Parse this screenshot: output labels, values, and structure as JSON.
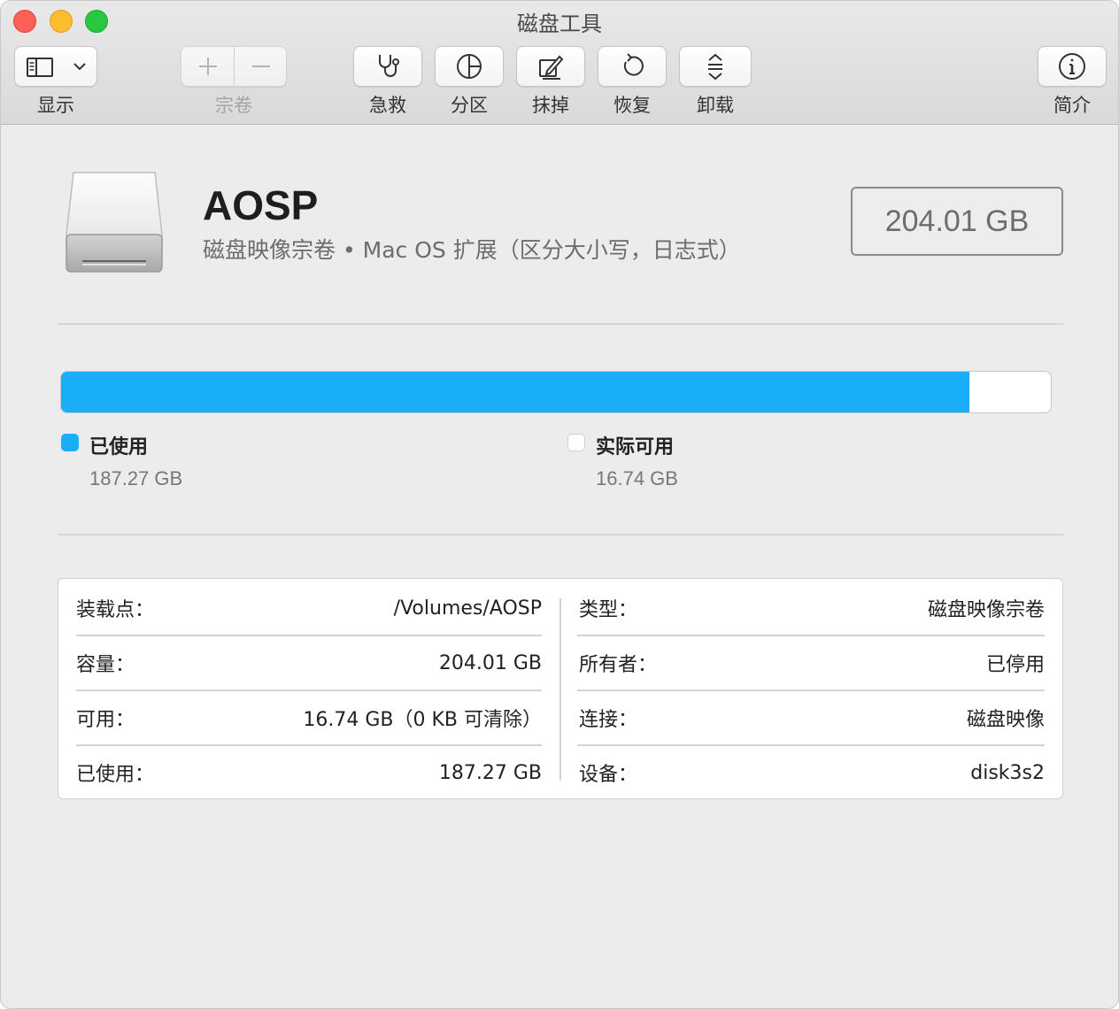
{
  "window": {
    "title": "磁盘工具"
  },
  "toolbar": {
    "view_label": "显示",
    "volume_label": "宗卷",
    "first_aid_label": "急救",
    "partition_label": "分区",
    "erase_label": "抹掉",
    "restore_label": "恢复",
    "unmount_label": "卸载",
    "info_label": "简介"
  },
  "volume": {
    "name": "AOSP",
    "subtitle": "磁盘映像宗卷 • Mac OS 扩展（区分大小写，日志式）",
    "capacity": "204.01 GB"
  },
  "usage": {
    "used_fraction": 0.918,
    "used_color": "#1aadf8",
    "free_color": "#ffffff",
    "used_label": "已使用",
    "used_value": "187.27 GB",
    "free_label": "实际可用",
    "free_value": "16.74 GB"
  },
  "info": {
    "left": [
      {
        "key": "装载点：",
        "value": "/Volumes/AOSP"
      },
      {
        "key": "容量：",
        "value": "204.01 GB"
      },
      {
        "key": "可用：",
        "value": "16.74 GB（0 KB 可清除）"
      },
      {
        "key": "已使用：",
        "value": "187.27 GB"
      }
    ],
    "right": [
      {
        "key": "类型：",
        "value": "磁盘映像宗卷"
      },
      {
        "key": "所有者：",
        "value": "已停用"
      },
      {
        "key": "连接：",
        "value": "磁盘映像"
      },
      {
        "key": "设备：",
        "value": "disk3s2"
      }
    ]
  }
}
